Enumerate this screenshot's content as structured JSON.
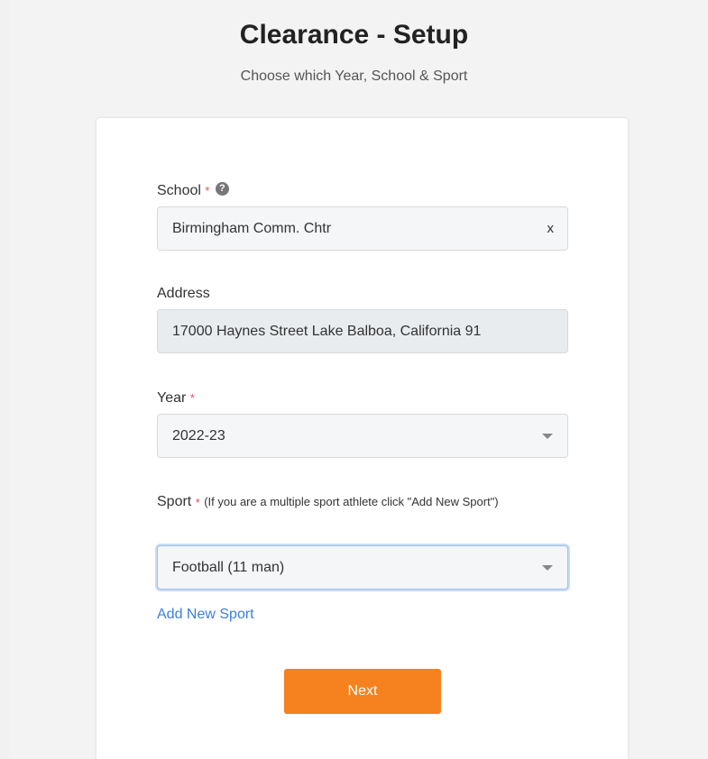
{
  "header": {
    "title": "Clearance - Setup",
    "subtitle": "Choose which Year, School & Sport"
  },
  "form": {
    "school": {
      "label": "School",
      "required_mark": "*",
      "help_icon": "?",
      "value": "Birmingham Comm. Chtr",
      "clear_symbol": "x"
    },
    "address": {
      "label": "Address",
      "value": "17000 Haynes Street Lake Balboa, California 91"
    },
    "year": {
      "label": "Year",
      "required_mark": "*",
      "value": "2022-23"
    },
    "sport": {
      "label": "Sport",
      "required_mark": "*",
      "hint": "(If you are a multiple sport athlete click \"Add New Sport\")",
      "value": "Football (11 man)"
    },
    "add_sport_link": "Add New Sport",
    "next_button": "Next"
  },
  "colors": {
    "accent_orange": "#f5821f",
    "link_blue": "#3d7fd9",
    "required_red": "#e05252",
    "focus_border": "#9ec1ef"
  },
  "icons": {
    "help": "question-circle-icon",
    "dropdown": "caret-down-icon",
    "clear": "clear-x-icon"
  }
}
